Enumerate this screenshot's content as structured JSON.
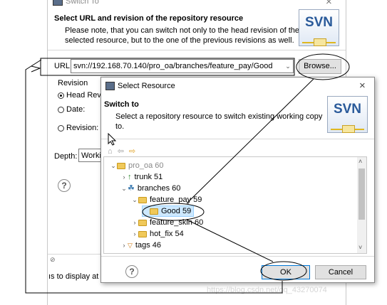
{
  "switch_dialog": {
    "title": "Switch To",
    "close_glyph": "×",
    "heading": "Select URL and revision of the repository resource",
    "description_line1": "Please note, that you can switch not only to the head revision of the",
    "description_line2": "selected resource, but to the one of the previous revisions as well.",
    "logo_text": "SVN",
    "url_label": "URL:",
    "url_value": "svn://192.168.70.140/pro_oa/branches/feature_pay/Good",
    "browse_label": "Browse...",
    "revision_group_label": "Revision",
    "head_revision_label": "Head Rev",
    "date_label": "Date:",
    "revision_label": "Revision:",
    "depth_label": "Depth:",
    "depth_value": "Worki",
    "bottom_text": "ıs to display at"
  },
  "select_dialog": {
    "title": "Select Resource",
    "close_glyph": "×",
    "heading": "Switch to",
    "description_line1": "Select a repository resource to switch existing working copy",
    "description_line2": "to.",
    "logo_text": "SVN",
    "tree": [
      {
        "label": "pro_oa 60",
        "indent": 0,
        "chevron": "down",
        "icon": "folder",
        "muted": true
      },
      {
        "label": "trunk 51",
        "indent": 1,
        "chevron": "right",
        "icon": "trunk"
      },
      {
        "label": "branches 60",
        "indent": 1,
        "chevron": "down",
        "icon": "branches"
      },
      {
        "label": "feature_pay 59",
        "indent": 2,
        "chevron": "down",
        "icon": "folder"
      },
      {
        "label": "Good 59",
        "indent": 3,
        "chevron": "",
        "icon": "folder",
        "selected": true
      },
      {
        "label": "feature_skin 60",
        "indent": 2,
        "chevron": "right",
        "icon": "folder"
      },
      {
        "label": "hot_fix 54",
        "indent": 2,
        "chevron": "right",
        "icon": "folder"
      },
      {
        "label": "tags 46",
        "indent": 1,
        "chevron": "right",
        "icon": "tags"
      }
    ],
    "ok_label": "OK",
    "cancel_label": "Cancel",
    "help_glyph": "?"
  },
  "watermark": "https://blog.csdn.net/qq_43270074",
  "colors": {
    "accent": "#0078d7",
    "folder": "#f0c95a",
    "annotation": "#000000"
  }
}
